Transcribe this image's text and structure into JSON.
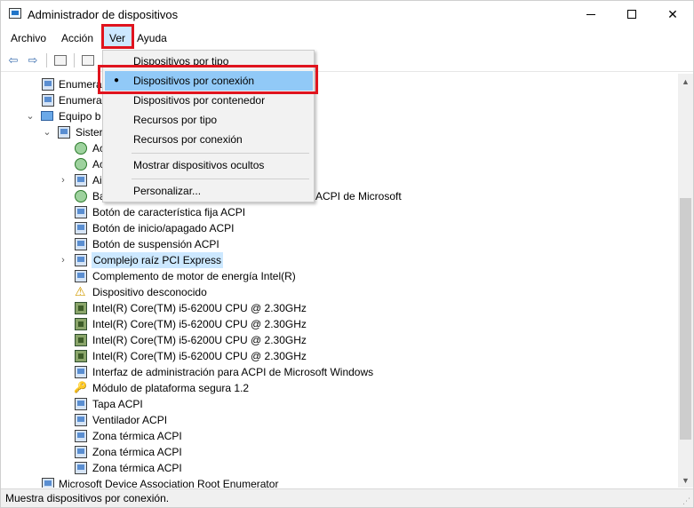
{
  "window": {
    "title": "Administrador de dispositivos"
  },
  "menubar": {
    "items": [
      "Archivo",
      "Acción",
      "Ver",
      "Ayuda"
    ]
  },
  "dropdown": {
    "items": [
      "Dispositivos por tipo",
      "Dispositivos por conexión",
      "Dispositivos por contenedor",
      "Recursos por tipo",
      "Recursos por conexión",
      "Mostrar dispositivos ocultos",
      "Personalizar..."
    ],
    "selected_marker": "●"
  },
  "tree": {
    "rows": [
      "Enumera",
      "Enumera",
      "Equipo b",
      "Sister",
      "Ac",
      "Ac",
      "Ai",
      "Ba",
      "ACPI de Microsoft",
      "Botón de característica fija ACPI",
      "Botón de inicio/apagado ACPI",
      "Botón de suspensión ACPI",
      "Complejo raíz PCI Express",
      "Complemento de motor de energía Intel(R)",
      "Dispositivo desconocido",
      "Intel(R) Core(TM) i5-6200U CPU @ 2.30GHz",
      "Intel(R) Core(TM) i5-6200U CPU @ 2.30GHz",
      "Intel(R) Core(TM) i5-6200U CPU @ 2.30GHz",
      "Intel(R) Core(TM) i5-6200U CPU @ 2.30GHz",
      "Interfaz de administración para ACPI de Microsoft Windows",
      "Módulo de plataforma segura 1.2",
      "Tapa ACPI",
      "Ventilador ACPI",
      "Zona térmica ACPI",
      "Zona térmica ACPI",
      "Zona térmica ACPI",
      "Microsoft Device Association Root Enumerator"
    ]
  },
  "statusbar": {
    "text": "Muestra dispositivos por conexión."
  },
  "colors": {
    "highlight_red": "#e0141e",
    "menu_hover": "#91c9f7",
    "selection": "#cce8ff"
  }
}
